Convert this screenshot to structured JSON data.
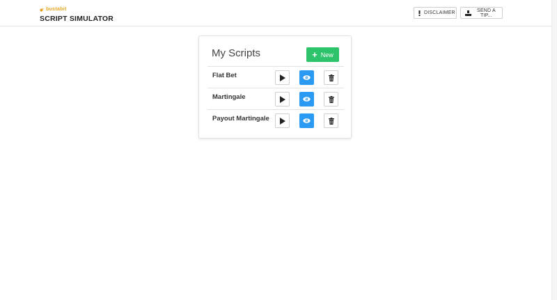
{
  "brand": {
    "logo_text": "bustabit",
    "title": "SCRIPT SIMULATOR",
    "logo_color": "#e6a420"
  },
  "header": {
    "disclaimer_label": "DISCLAIMER",
    "disclaimer_icon": "exclamation-icon",
    "tip_label": "SEND A TIP...",
    "tip_icon": "tip-jar-icon"
  },
  "scripts_panel": {
    "title": "My Scripts",
    "new_label": "New",
    "new_color": "#2cc36b",
    "view_color": "#2b9af3",
    "scripts": [
      {
        "name": "Flat Bet"
      },
      {
        "name": "Martingale"
      },
      {
        "name": "Payout Martingale"
      }
    ]
  }
}
